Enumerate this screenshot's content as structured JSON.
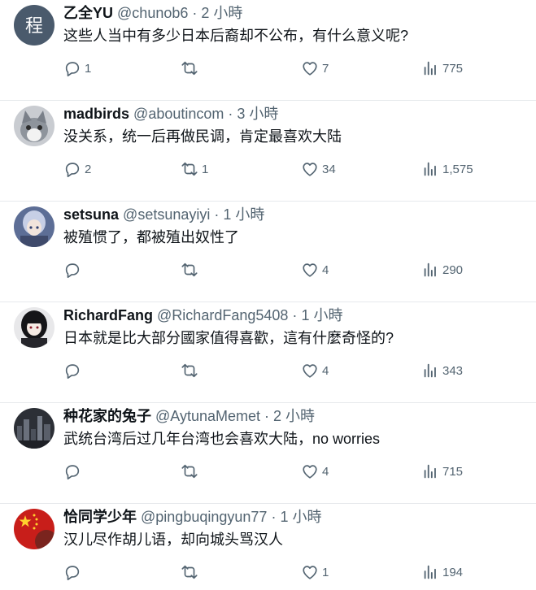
{
  "tweets": [
    {
      "name": "乙全YU",
      "handle": "@chunob6",
      "dot": "·",
      "time": "2 小時",
      "text": "这些人当中有多少日本后裔却不公布，有什么意义呢?",
      "reply_count": "1",
      "retweet_count": "",
      "like_count": "7",
      "view_count": "775",
      "avatar_glyph": "程",
      "avatar_color": "#4a5a6c"
    },
    {
      "name": "madbirds",
      "handle": "@aboutincom",
      "dot": "·",
      "time": "3 小時",
      "text": "没关系，统一后再做民调，肯定最喜欢大陆",
      "reply_count": "2",
      "retweet_count": "1",
      "like_count": "34",
      "view_count": "1,575",
      "avatar_color": "#9aa0a8"
    },
    {
      "name": "setsuna",
      "handle": "@setsunayiyi",
      "dot": "·",
      "time": "1 小時",
      "text": "被殖惯了，都被殖出奴性了",
      "reply_count": "",
      "retweet_count": "",
      "like_count": "4",
      "view_count": "290",
      "avatar_color": "#6f7fa6"
    },
    {
      "name": "RichardFang",
      "handle": "@RichardFang5408",
      "dot": "·",
      "time": "1 小時",
      "text": "日本就是比大部分國家值得喜歡，這有什麼奇怪的?",
      "reply_count": "",
      "retweet_count": "",
      "like_count": "4",
      "view_count": "343",
      "avatar_color": "#2a2a2e"
    },
    {
      "name": "种花家的兔子",
      "handle": "@AytunaMemet",
      "dot": "·",
      "time": "2 小時",
      "text": "武统台湾后过几年台湾也会喜欢大陆，no worries",
      "reply_count": "",
      "retweet_count": "",
      "like_count": "4",
      "view_count": "715",
      "avatar_color": "#3a3d44"
    },
    {
      "name": "恰同学少年",
      "handle": "@pingbuqingyun77",
      "dot": "·",
      "time": "1 小時",
      "text": "汉儿尽作胡儿语，却向城头骂汉人",
      "reply_count": "",
      "retweet_count": "",
      "like_count": "1",
      "view_count": "194",
      "avatar_color": "#d0211c"
    }
  ],
  "icons": {
    "reply": "reply-icon",
    "retweet": "retweet-icon",
    "like": "like-icon",
    "views": "views-icon"
  },
  "colors": {
    "text": "#0f1419",
    "secondary": "#536471",
    "divider": "#e6e9ec"
  }
}
